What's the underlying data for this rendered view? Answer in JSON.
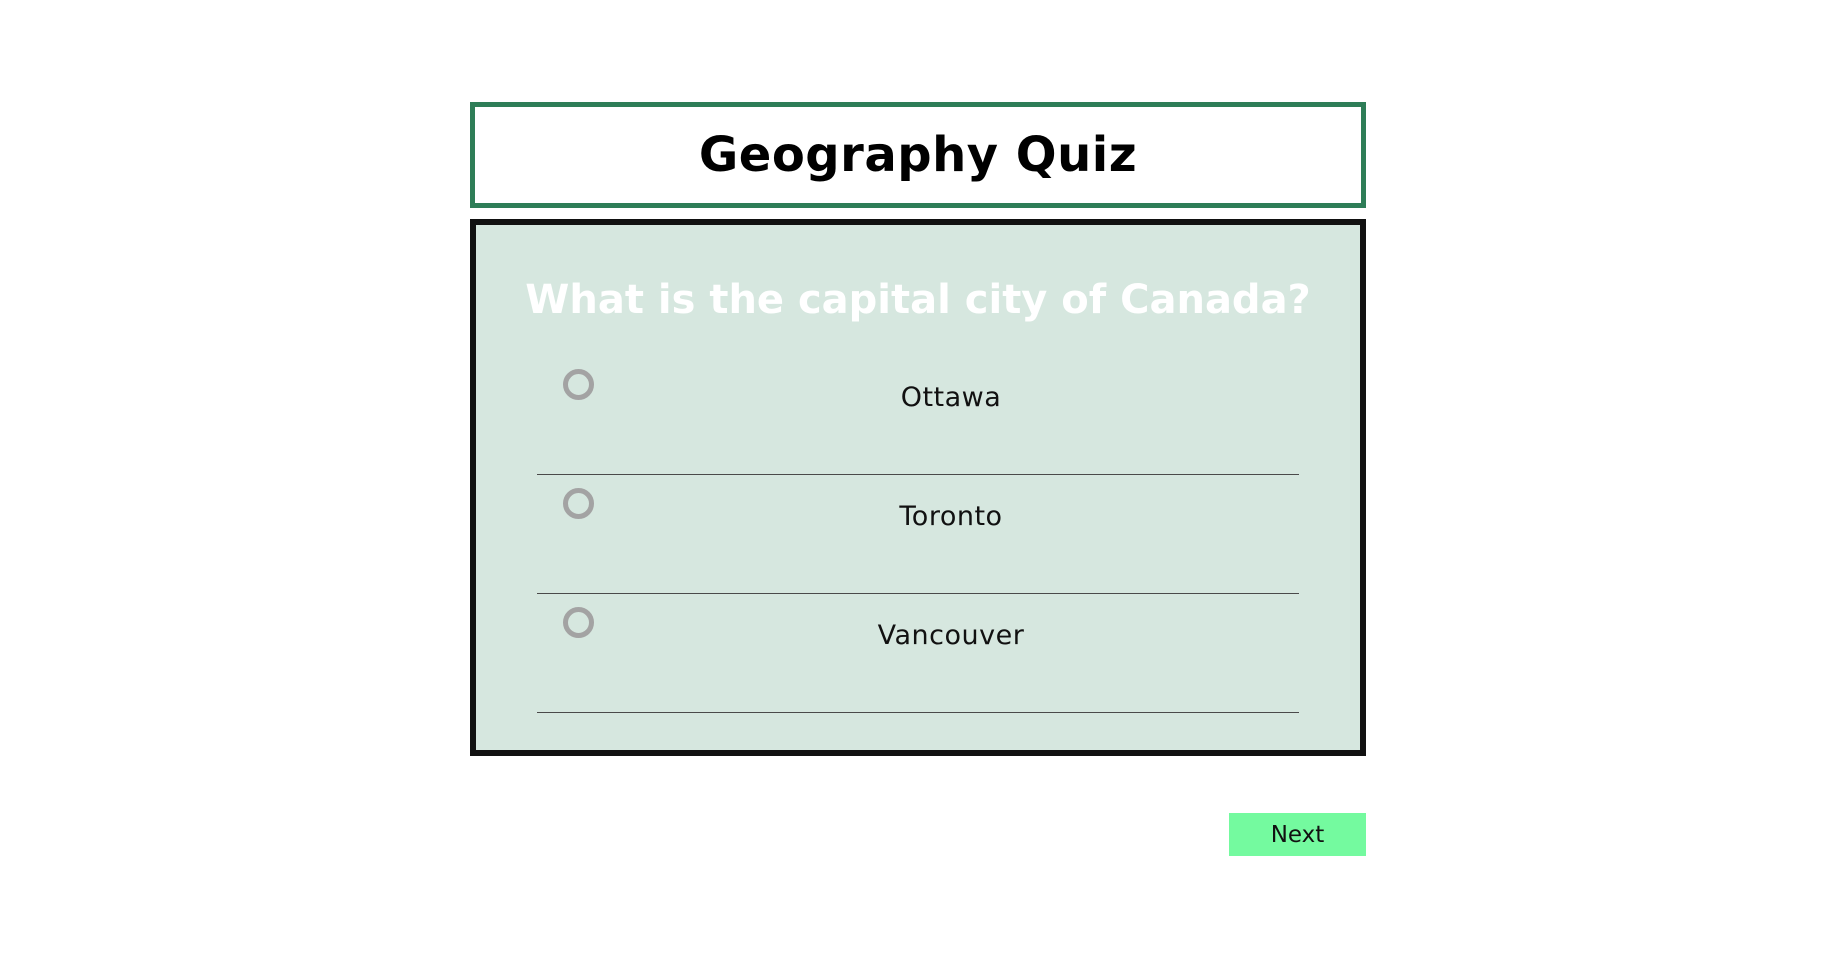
{
  "header": {
    "title": "Geography Quiz"
  },
  "quiz": {
    "question": "What is the capital city of Canada?",
    "options": [
      {
        "label": "Ottawa",
        "selected": false
      },
      {
        "label": "Toronto",
        "selected": false
      },
      {
        "label": "Vancouver",
        "selected": false
      }
    ]
  },
  "footer": {
    "next_label": "Next"
  },
  "colors": {
    "title_border": "#2e7d57",
    "panel_background": "#d6e7df",
    "panel_border": "#111111",
    "question_text": "#ffffff",
    "radio_ring": "#a3a3a3",
    "next_button": "#74fa9f"
  }
}
